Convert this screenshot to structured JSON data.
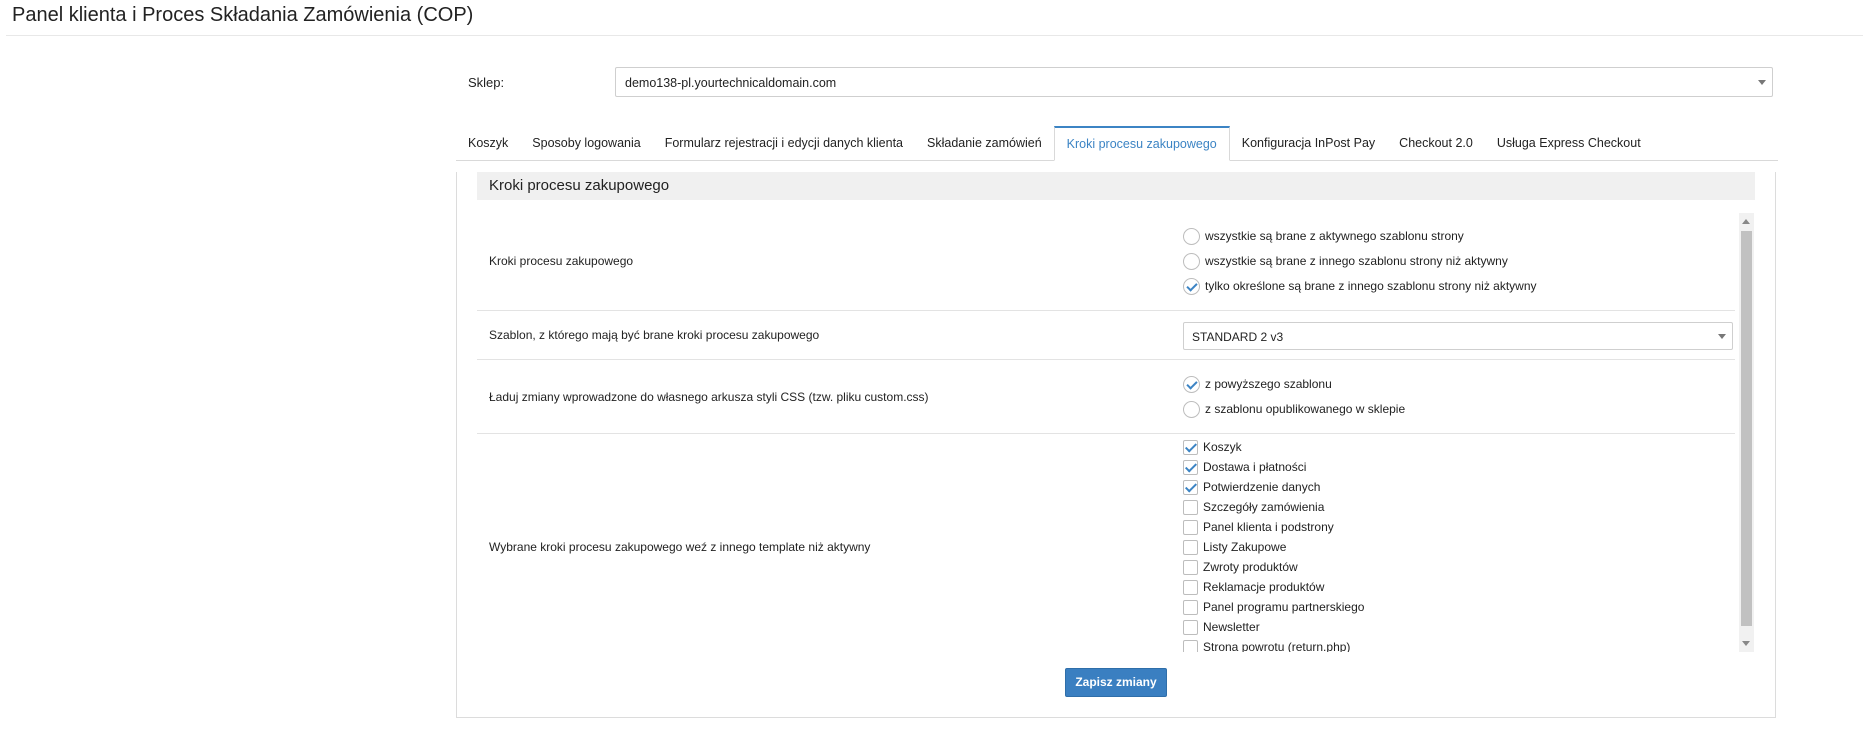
{
  "title": "Panel klienta i Proces Składania Zamówienia (COP)",
  "shop": {
    "label": "Sklep:",
    "value": "demo138-pl.yourtechnicaldomain.com"
  },
  "tabs": [
    {
      "label": "Koszyk"
    },
    {
      "label": "Sposoby logowania"
    },
    {
      "label": "Formularz rejestracji i edycji danych klienta"
    },
    {
      "label": "Składanie zamówień"
    },
    {
      "label": "Kroki procesu zakupowego"
    },
    {
      "label": "Konfiguracja InPost Pay"
    },
    {
      "label": "Checkout 2.0"
    },
    {
      "label": "Usługa Express Checkout"
    }
  ],
  "active_tab": "Kroki procesu zakupowego",
  "section": {
    "title": "Kroki procesu zakupowego",
    "rows": [
      {
        "label": "Kroki procesu zakupowego",
        "options": [
          {
            "label": "wszystkie są brane z aktywnego szablonu strony",
            "checked": false
          },
          {
            "label": "wszystkie są brane z innego szablonu strony niż aktywny",
            "checked": false
          },
          {
            "label": "tylko określone są brane z innego szablonu strony niż aktywny",
            "checked": true
          }
        ]
      },
      {
        "label": "Szablon, z którego mają być brane kroki procesu zakupowego",
        "select_value": "STANDARD 2 v3"
      },
      {
        "label": "Ładuj zmiany wprowadzone do własnego arkusza styli CSS (tzw. pliku custom.css)",
        "options": [
          {
            "label": "z powyższego szablonu",
            "checked": true
          },
          {
            "label": "z szablonu opublikowanego w sklepie",
            "checked": false
          }
        ]
      },
      {
        "label": "Wybrane kroki procesu zakupowego weź z innego template niż aktywny",
        "checkboxes": [
          {
            "label": "Koszyk",
            "checked": true
          },
          {
            "label": "Dostawa i płatności",
            "checked": true
          },
          {
            "label": "Potwierdzenie danych",
            "checked": true
          },
          {
            "label": "Szczegóły zamówienia",
            "checked": false
          },
          {
            "label": "Panel klienta i podstrony",
            "checked": false
          },
          {
            "label": "Listy Zakupowe",
            "checked": false
          },
          {
            "label": "Zwroty produktów",
            "checked": false
          },
          {
            "label": "Reklamacje produktów",
            "checked": false
          },
          {
            "label": "Panel programu partnerskiego",
            "checked": false
          },
          {
            "label": "Newsletter",
            "checked": false
          },
          {
            "label": "Strona powrotu (return.php)",
            "checked": false
          }
        ]
      }
    ]
  },
  "save_button": "Zapisz zmiany",
  "colors": {
    "accent": "#3c84c4",
    "button": "#3a7fc1"
  }
}
